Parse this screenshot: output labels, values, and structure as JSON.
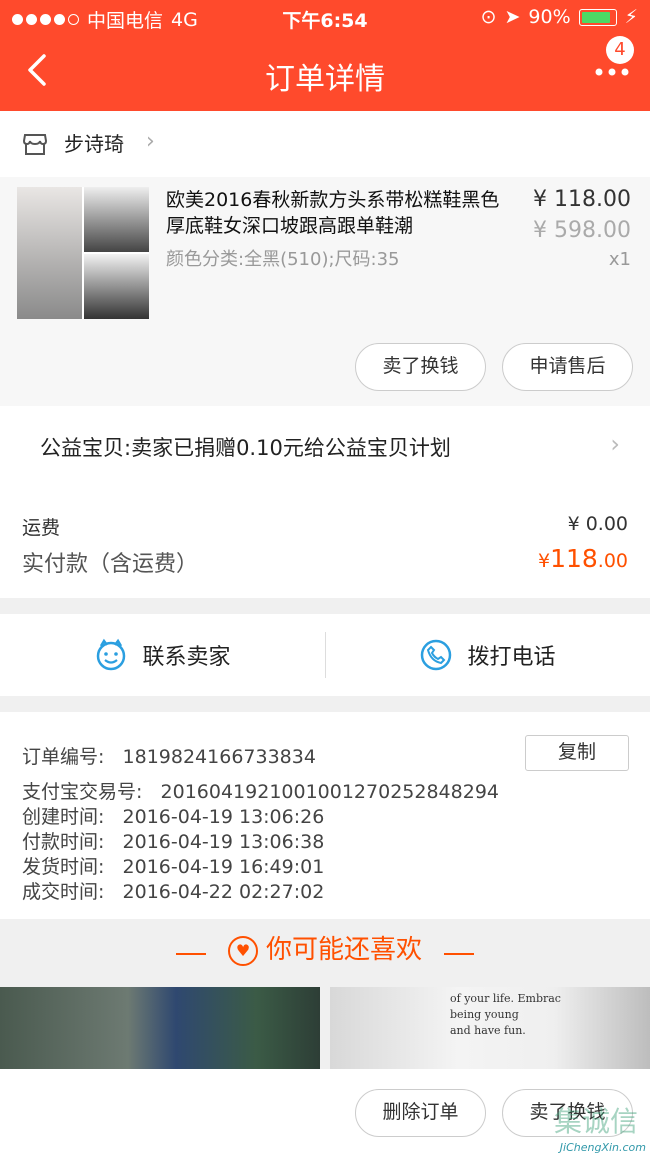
{
  "status_bar": {
    "carrier": "中国电信",
    "network": "4G",
    "time": "下午6:54",
    "battery": "90%"
  },
  "nav": {
    "title": "订单详情",
    "badge_count": "4"
  },
  "shop": {
    "name": "步诗琦",
    "chevron": "›"
  },
  "product": {
    "title": "欧美2016春秋新款方头系带松糕鞋黑色厚底鞋女深口坡跟高跟单鞋潮",
    "sku": "颜色分类:全黑(510);尺码:35",
    "price": "¥ 118.00",
    "original_price": "¥ 598.00",
    "quantity": "x1",
    "btn_sell": "卖了换钱",
    "btn_after_sale": "申请售后"
  },
  "charity": {
    "text": "公益宝贝:卖家已捐赠0.10元给公益宝贝计划",
    "chevron": "›"
  },
  "fee": {
    "shipping_label": "运费",
    "shipping_value": "¥ 0.00",
    "paid_label": "实付款（含运费）",
    "paid_currency": "¥",
    "paid_int": "118",
    "paid_dec": ".00"
  },
  "contact": {
    "seller": "联系卖家",
    "phone": "拨打电话"
  },
  "order_info": {
    "order_no": "订单编号:   1819824166733834",
    "alipay_no": "支付宝交易号:   2016041921001001270252848294",
    "created": "创建时间:   2016-04-19 13:06:26",
    "paid": "付款时间:   2016-04-19 13:06:38",
    "shipped": "发货时间:   2016-04-19 16:49:01",
    "completed": "成交时间:   2016-04-22 02:27:02",
    "copy_label": "复制"
  },
  "recommend": {
    "title": "你可能还喜欢",
    "shirt_text": [
      "of your life. Embrac",
      "being young",
      "and have fun."
    ]
  },
  "bottom": {
    "delete_order": "删除订单",
    "sell": "卖了换钱",
    "watermark": "JiChengXin.com",
    "watermark_cn": "集诚信"
  },
  "colors": {
    "accent": "#ff4a2c",
    "price_highlight": "#ff5000",
    "link_blue": "#2b9fe0"
  }
}
